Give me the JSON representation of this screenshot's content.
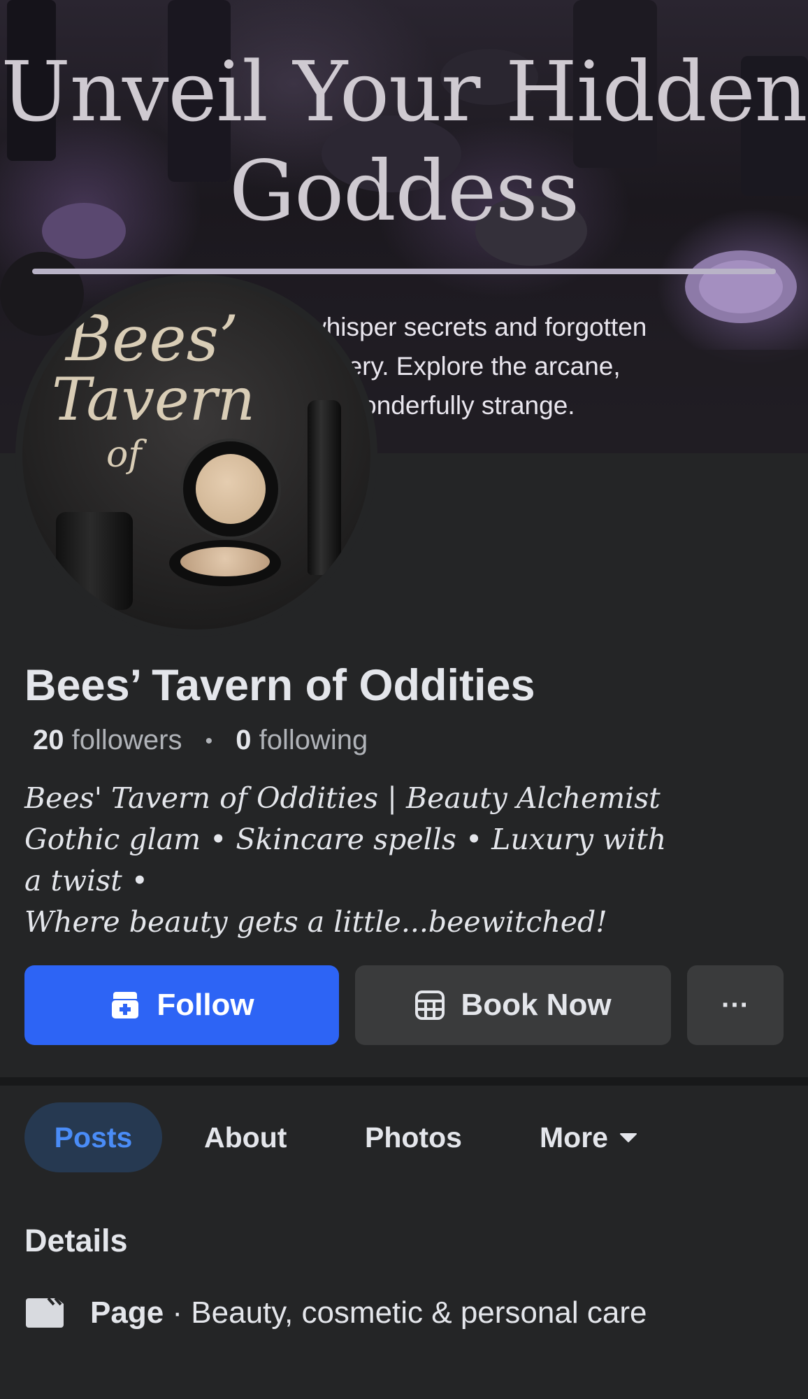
{
  "cover": {
    "title_line1": "Unveil Your Hidden",
    "title_line2": "Goddess",
    "tagline_line1": "whisper secrets and forgotten",
    "tagline_line2": "covery. Explore the arcane,",
    "tagline_line3": "he wonderfully strange."
  },
  "avatar": {
    "line1": "Bees’",
    "line2": "Tavern",
    "line3": "of"
  },
  "profile": {
    "name": "Bees’ Tavern of Oddities",
    "followers_count": "20",
    "followers_label": "followers",
    "following_count": "0",
    "following_label": "following",
    "separator": "•",
    "bio": [
      "Bees' Tavern of Oddities | Beauty Alchemist",
      "Gothic glam • Skincare spells • Luxury with",
      "a twist •",
      "Where beauty gets a little...beewitched!"
    ]
  },
  "actions": {
    "follow_label": "Follow",
    "book_label": "Book Now",
    "more_label": "···"
  },
  "tabs": [
    "Posts",
    "About",
    "Photos",
    "More"
  ],
  "active_tab": "Posts",
  "details": {
    "title": "Details",
    "page_type_label": "Page",
    "page_type_separator": " · ",
    "page_category": "Beauty, cosmetic & personal care"
  },
  "colors": {
    "background": "#242526",
    "primary_button": "#2d64f5",
    "secondary_button": "#3a3b3c",
    "active_tab_bg": "#263951",
    "active_tab_text": "#4a8cf7"
  },
  "icons": {
    "follow": "add-friend-icon",
    "book": "calendar-icon",
    "more_caret": "caret-down-icon",
    "details_page": "flag-icon"
  }
}
